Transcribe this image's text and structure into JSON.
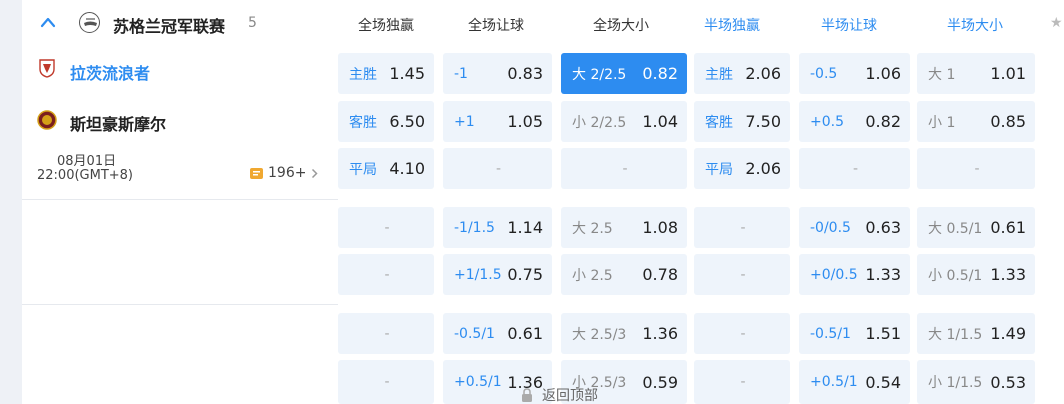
{
  "league": {
    "name": "苏格兰冠军联赛",
    "count": "5"
  },
  "columns": [
    "全场独赢",
    "全场让球",
    "全场大小",
    "半场独赢",
    "半场让球",
    "半场大小"
  ],
  "pin_glyph": "★",
  "match": {
    "home_team": "拉茨流浪者",
    "away_team": "斯坦豪斯摩尔",
    "date": "08月01日",
    "time": "22:00(GMT+8)",
    "more_markets": "196+"
  },
  "back_to_top": "返回顶部",
  "rows": [
    [
      {
        "label": "主胜",
        "value": "1.45"
      },
      {
        "label": "-1",
        "value": "0.83"
      },
      {
        "label": "大 2/2.5",
        "value": "0.82",
        "selected": true
      },
      {
        "label": "主胜",
        "value": "2.06"
      },
      {
        "label": "-0.5",
        "value": "1.06"
      },
      {
        "label": "大 1",
        "value": "1.01",
        "muted": true
      }
    ],
    [
      {
        "label": "客胜",
        "value": "6.50"
      },
      {
        "label": "+1",
        "value": "1.05"
      },
      {
        "label": "小 2/2.5",
        "value": "1.04",
        "muted": true
      },
      {
        "label": "客胜",
        "value": "7.50"
      },
      {
        "label": "+0.5",
        "value": "0.82"
      },
      {
        "label": "小 1",
        "value": "0.85",
        "muted": true
      }
    ],
    [
      {
        "label": "平局",
        "value": "4.10"
      },
      {
        "dash": "-"
      },
      {
        "dash": "-"
      },
      {
        "label": "平局",
        "value": "2.06"
      },
      {
        "dash": "-"
      },
      {
        "dash": "-"
      }
    ],
    [
      {
        "dash": "-"
      },
      {
        "label": "-1/1.5",
        "value": "1.14"
      },
      {
        "label": "大 2.5",
        "value": "1.08",
        "muted": true
      },
      {
        "dash": "-"
      },
      {
        "label": "-0/0.5",
        "value": "0.63"
      },
      {
        "label": "大 0.5/1",
        "value": "0.61",
        "muted": true
      }
    ],
    [
      {
        "dash": "-"
      },
      {
        "label": "+1/1.5",
        "value": "0.75"
      },
      {
        "label": "小 2.5",
        "value": "0.78",
        "muted": true
      },
      {
        "dash": "-"
      },
      {
        "label": "+0/0.5",
        "value": "1.33"
      },
      {
        "label": "小 0.5/1",
        "value": "1.33",
        "muted": true
      }
    ],
    [
      {
        "dash": "-"
      },
      {
        "label": "-0.5/1",
        "value": "0.61"
      },
      {
        "label": "大 2.5/3",
        "value": "1.36",
        "muted": true
      },
      {
        "dash": "-"
      },
      {
        "label": "-0.5/1",
        "value": "1.51"
      },
      {
        "label": "大 1/1.5",
        "value": "1.49",
        "muted": true
      }
    ],
    [
      {
        "dash": "-"
      },
      {
        "label": "+0.5/1",
        "value": "1.36"
      },
      {
        "label": "小 2.5/3",
        "value": "0.59",
        "muted": true
      },
      {
        "dash": "-"
      },
      {
        "label": "+0.5/1",
        "value": "0.54"
      },
      {
        "label": "小 1/1.5",
        "value": "0.53",
        "muted": true
      }
    ]
  ],
  "colors": {
    "accent": "#2d8cf0",
    "cell_bg": "#eef4fb",
    "home_team": "#2d8cf0"
  }
}
